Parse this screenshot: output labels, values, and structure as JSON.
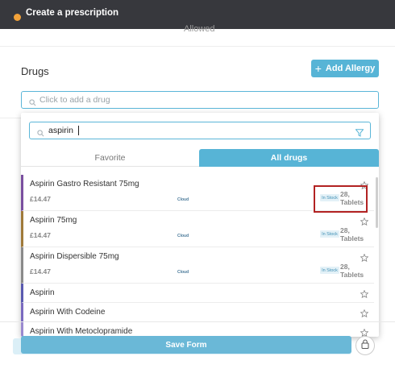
{
  "window": {
    "title": "Create a prescription"
  },
  "header_ghost_text": "Allowed",
  "drugs_section": {
    "label": "Drugs",
    "add_allergy_label": "Add Allergy",
    "drug_input_placeholder": "Click to add a drug"
  },
  "dropdown": {
    "search_value": "aspirin",
    "tabs": [
      {
        "label": "Favorite",
        "active": false
      },
      {
        "label": "All drugs",
        "active": true
      }
    ],
    "items": [
      {
        "name": "Aspirin Gastro Resistant 75mg",
        "price": "£14.47",
        "supplier": "Cloud",
        "stock": "In Stock",
        "qty": "28,",
        "unit": "Tablets",
        "accent": "#7a4fa0"
      },
      {
        "name": "Aspirin 75mg",
        "price": "£14.47",
        "supplier": "Cloud",
        "stock": "In Stock",
        "qty": "28,",
        "unit": "Tablets",
        "accent": "#a07a3a"
      },
      {
        "name": "Aspirin Dispersible 75mg",
        "price": "£14.47",
        "supplier": "Cloud",
        "stock": "In Stock",
        "qty": "28,",
        "unit": "Tablets",
        "accent": "#8a8a8a"
      },
      {
        "name": "Aspirin",
        "accent": "#5a5ab0"
      },
      {
        "name": "Aspirin With Codeine",
        "accent": "#7a6ac0"
      },
      {
        "name": "Aspirin With Metoclopramide",
        "accent": "#9a8ad0"
      }
    ]
  },
  "footer": {
    "save_label": "Save Form"
  },
  "colors": {
    "accent": "#57b4d6",
    "topbar": "#37383d",
    "highlight": "#b22222"
  }
}
